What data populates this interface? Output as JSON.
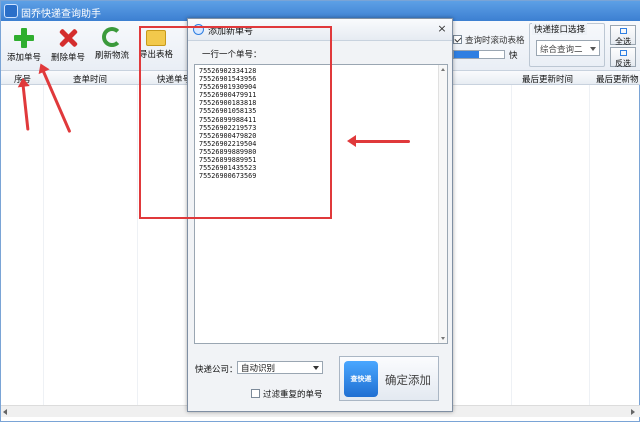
{
  "app": {
    "title": "固乔快递查询助手"
  },
  "toolbar": {
    "buttons": [
      {
        "label": "添加单号",
        "icon": "add-icon"
      },
      {
        "label": "删除单号",
        "icon": "delete-icon"
      },
      {
        "label": "刷新物流",
        "icon": "refresh-icon"
      },
      {
        "label": "导出表格",
        "icon": "export-icon"
      }
    ],
    "query_scroll_label": "查询时滚动表格",
    "progress_label": "快",
    "progress_fraction": 0.5,
    "api_group_label": "快递接口选择",
    "api_selected": "综合查询二",
    "select_all_label": "全选",
    "invert_label": "反选"
  },
  "grid": {
    "columns": [
      "序号",
      "查单时间",
      "快递单号",
      "最后更新时间",
      "最后更新物"
    ]
  },
  "dialog": {
    "title": "添加新单号",
    "close_glyph": "×",
    "instruction": "一行一个单号：",
    "tracking_numbers": [
      "75526902334128",
      "75526901543956",
      "75526901930904",
      "75526900479911",
      "75526900183818",
      "75526901058135",
      "75526899988411",
      "75526902219573",
      "75526900479820",
      "75526902219504",
      "75526899889980",
      "75526899889951",
      "75526901435523",
      "75526900673569"
    ],
    "courier_label": "快递公司：",
    "courier_selected": "自动识别",
    "dedupe_label": "过滤重复的单号",
    "confirm_logo_text": "查快递",
    "confirm_label": "确定添加"
  },
  "colors": {
    "annotation_red": "#e0393b",
    "title_blue": "#3c7fd1"
  }
}
